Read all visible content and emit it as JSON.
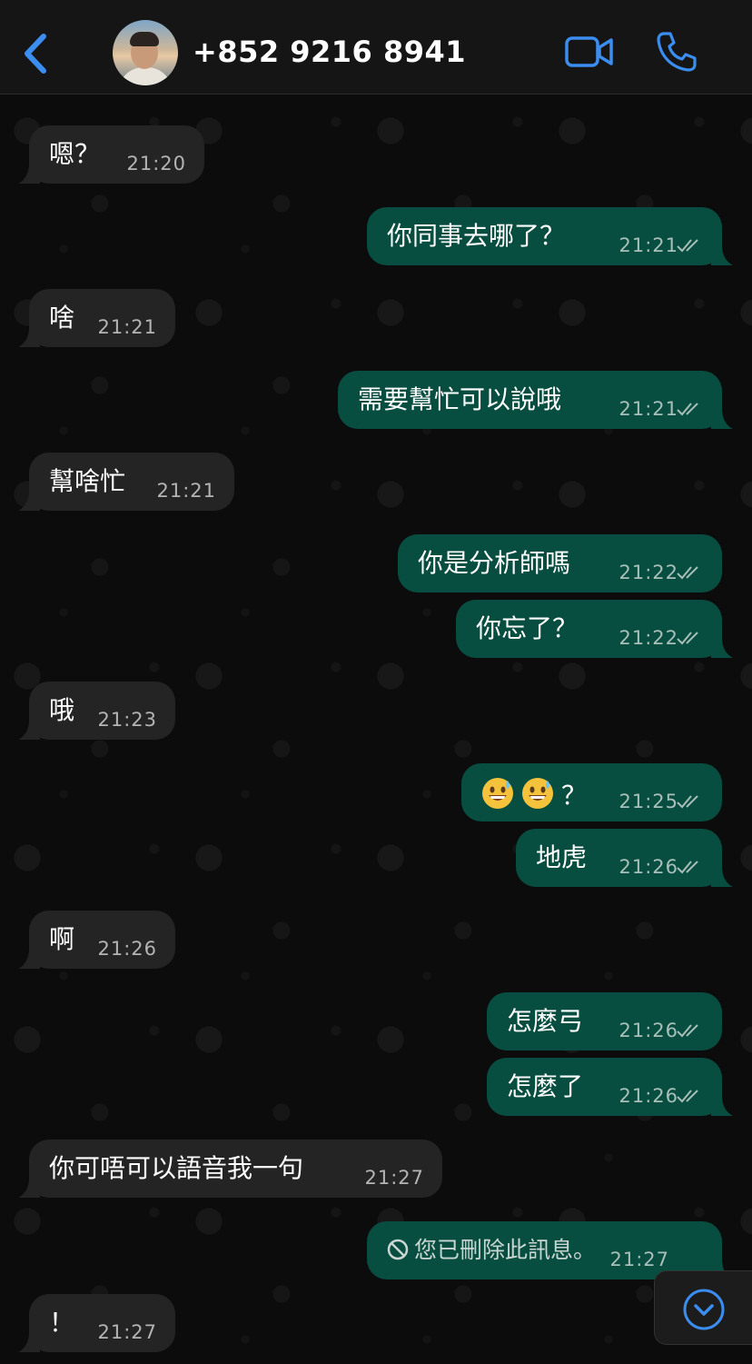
{
  "header": {
    "contact": "+852 9216 8941",
    "back_icon": "chevron-left-icon",
    "video_icon": "video-camera-icon",
    "call_icon": "phone-icon",
    "accent": "#3b8ef0"
  },
  "messages": [
    {
      "dir": "in",
      "text": "嗯？",
      "time": "21:20"
    },
    {
      "dir": "out",
      "text": "你同事去哪了？",
      "time": "21:21"
    },
    {
      "dir": "in",
      "text": "啥",
      "time": "21:21"
    },
    {
      "dir": "out",
      "text": "需要幫忙可以說哦",
      "time": "21:21"
    },
    {
      "dir": "in",
      "text": "幫啥忙",
      "time": "21:21"
    },
    {
      "dir": "out",
      "text": "你是分析師嗎",
      "time": "21:22"
    },
    {
      "dir": "out",
      "text": "你忘了？",
      "time": "21:22"
    },
    {
      "dir": "in",
      "text": "哦",
      "time": "21:23"
    },
    {
      "dir": "out",
      "text": "？",
      "time": "21:25",
      "emoji": "grinning-sweat-emoji"
    },
    {
      "dir": "out",
      "text": "地虎",
      "time": "21:26"
    },
    {
      "dir": "in",
      "text": "啊",
      "time": "21:26"
    },
    {
      "dir": "out",
      "text": "怎麼弓",
      "time": "21:26"
    },
    {
      "dir": "out",
      "text": "怎麼了",
      "time": "21:26"
    },
    {
      "dir": "in",
      "text": "你可唔可以語音我一句",
      "time": "21:27"
    },
    {
      "dir": "out",
      "text": "您已刪除此訊息。",
      "time": "21:27",
      "deleted": true
    },
    {
      "dir": "in",
      "text": "！",
      "time": "21:27"
    }
  ],
  "scroll_icon": "chevron-down-circle-icon",
  "colors": {
    "incoming_bubble": "#242424",
    "outgoing_bubble": "#074d40",
    "background": "#0b0b0b"
  }
}
